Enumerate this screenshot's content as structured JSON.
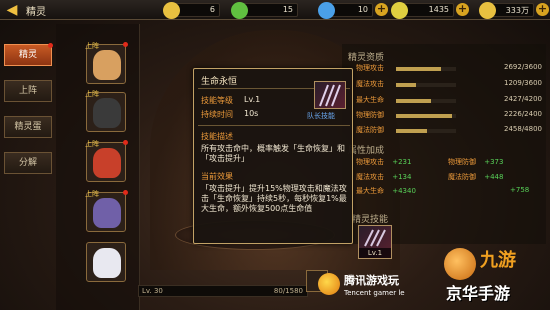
{
  "header": {
    "back_icon": "back-arrow-icon",
    "title": "精灵",
    "resources": [
      {
        "name": "gold-coin-icon",
        "value": "6",
        "color": "#e8c040"
      },
      {
        "name": "leaf-icon",
        "value": "15",
        "color": "#60c040"
      },
      {
        "name": "diamond-icon",
        "value": "10",
        "color": "#4aa0e8"
      },
      {
        "name": "energy-icon",
        "value": "1435",
        "color": "#e0d040"
      },
      {
        "name": "gold-coin-icon",
        "value": "333万",
        "color": "#e8c040"
      }
    ]
  },
  "nav": {
    "items": [
      {
        "label": "精灵",
        "active": true
      },
      {
        "label": "上阵",
        "active": false
      },
      {
        "label": "精灵蛋",
        "active": false
      },
      {
        "label": "分解",
        "active": false
      }
    ]
  },
  "portraits": [
    {
      "tag": "上阵",
      "color": "#d8a060"
    },
    {
      "tag": "上阵",
      "color": "#3a3a3a"
    },
    {
      "tag": "上阵",
      "color": "#c8402a"
    },
    {
      "tag": "上阵",
      "color": "#7060a8"
    },
    {
      "tag": "",
      "color": "#e8e8f0"
    }
  ],
  "stats": {
    "title": "精灵资质",
    "rows": [
      {
        "label": "物理攻击",
        "value": "2692/3600",
        "fill": 0.75
      },
      {
        "label": "魔法攻击",
        "value": "1209/3600",
        "fill": 0.34
      },
      {
        "label": "最大生命",
        "value": "2427/4200",
        "fill": 0.58
      },
      {
        "label": "物理防御",
        "value": "2226/2400",
        "fill": 0.93
      },
      {
        "label": "魔法防御",
        "value": "2458/4800",
        "fill": 0.51
      }
    ],
    "bonus_title": "属性加成",
    "bonus": [
      {
        "label": "物理攻击",
        "value": "+231",
        "label2": "物理防御",
        "value2": "+373"
      },
      {
        "label": "魔法攻击",
        "value": "+134",
        "label2": "魔法防御",
        "value2": "+448"
      },
      {
        "label": "最大生命",
        "value": "+4340",
        "label2": "",
        "value2": "+758"
      }
    ],
    "skill_title": "精灵技能",
    "skill_level": "Lv.1"
  },
  "tooltip": {
    "name": "生命永恒",
    "level_label": "技能等级",
    "level_value": "Lv.1",
    "duration_label": "持续时间",
    "duration_value": "10s",
    "skill_type": "队长技能",
    "desc_header": "技能描述",
    "desc": "所有攻击命中，概率触发「生命恢复」和「攻击提升」",
    "effect_header": "当前效果",
    "effect": "「攻击提升」提升15%物理攻击和魔法攻击「生命恢复」持续5秒，每秒恢复1%最大生命，额外恢复500点生命值"
  },
  "bottom": {
    "level": "Lv. 30",
    "exp": "80/1580"
  },
  "watermark": {
    "tencent_title": "腾讯游戏玩",
    "tencent_sub": "Tencent gamer le",
    "site_top": "九游",
    "site_bottom": "京华手游"
  }
}
